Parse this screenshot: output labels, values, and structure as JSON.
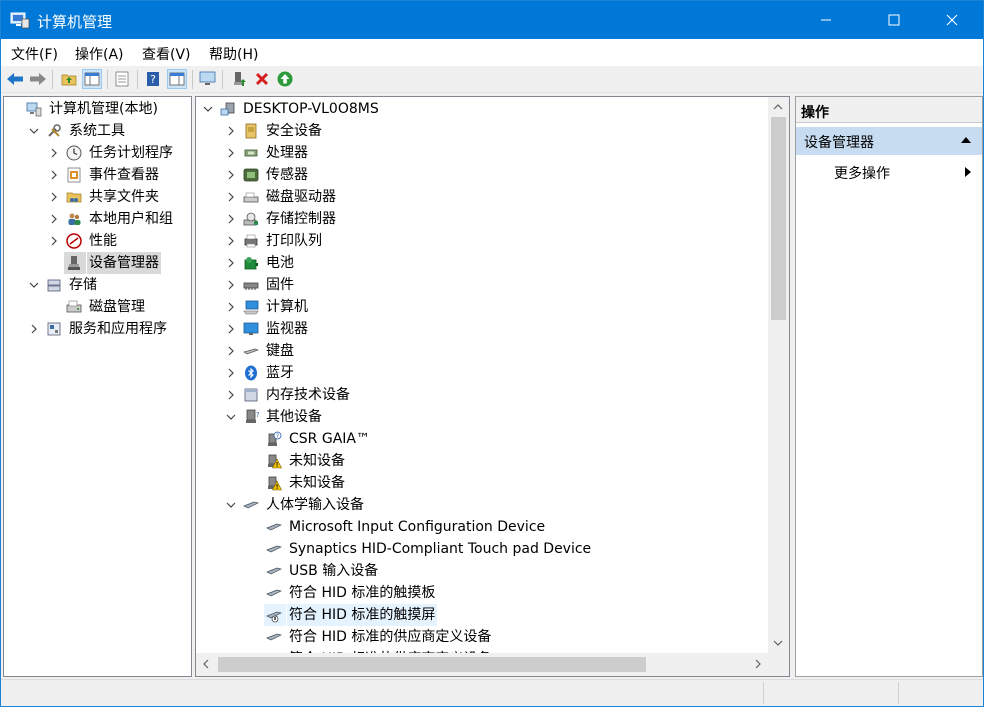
{
  "window": {
    "title": "计算机管理"
  },
  "menu": [
    {
      "label": "文件(F)"
    },
    {
      "label": "操作(A)"
    },
    {
      "label": "查看(V)"
    },
    {
      "label": "帮助(H)"
    }
  ],
  "left_tree": [
    {
      "label": "计算机管理(本地)",
      "indent": 0,
      "chevron": "",
      "icon": "computer-management-icon"
    },
    {
      "label": "系统工具",
      "indent": 1,
      "chevron": "down",
      "icon": "tools-icon"
    },
    {
      "label": "任务计划程序",
      "indent": 2,
      "chevron": "right",
      "icon": "clock-icon"
    },
    {
      "label": "事件查看器",
      "indent": 2,
      "chevron": "right",
      "icon": "event-viewer-icon"
    },
    {
      "label": "共享文件夹",
      "indent": 2,
      "chevron": "right",
      "icon": "shared-folder-icon"
    },
    {
      "label": "本地用户和组",
      "indent": 2,
      "chevron": "right",
      "icon": "users-icon"
    },
    {
      "label": "性能",
      "indent": 2,
      "chevron": "right",
      "icon": "performance-icon"
    },
    {
      "label": "设备管理器",
      "indent": 2,
      "chevron": "",
      "icon": "device-manager-icon",
      "selected": true
    },
    {
      "label": "存储",
      "indent": 1,
      "chevron": "down",
      "icon": "storage-icon"
    },
    {
      "label": "磁盘管理",
      "indent": 2,
      "chevron": "",
      "icon": "disk-management-icon"
    },
    {
      "label": "服务和应用程序",
      "indent": 1,
      "chevron": "right",
      "icon": "services-icon"
    }
  ],
  "device_tree": [
    {
      "label": "DESKTOP-VL0O8MS",
      "indent": 0,
      "chevron": "down",
      "icon": "computer-icon"
    },
    {
      "label": "安全设备",
      "indent": 1,
      "chevron": "right",
      "icon": "security-device-icon"
    },
    {
      "label": "处理器",
      "indent": 1,
      "chevron": "right",
      "icon": "processor-icon"
    },
    {
      "label": "传感器",
      "indent": 1,
      "chevron": "right",
      "icon": "sensor-icon"
    },
    {
      "label": "磁盘驱动器",
      "indent": 1,
      "chevron": "right",
      "icon": "disk-drive-icon"
    },
    {
      "label": "存储控制器",
      "indent": 1,
      "chevron": "right",
      "icon": "storage-controller-icon"
    },
    {
      "label": "打印队列",
      "indent": 1,
      "chevron": "right",
      "icon": "printer-icon"
    },
    {
      "label": "电池",
      "indent": 1,
      "chevron": "right",
      "icon": "battery-icon"
    },
    {
      "label": "固件",
      "indent": 1,
      "chevron": "right",
      "icon": "firmware-icon"
    },
    {
      "label": "计算机",
      "indent": 1,
      "chevron": "right",
      "icon": "monitor-icon"
    },
    {
      "label": "监视器",
      "indent": 1,
      "chevron": "right",
      "icon": "display-icon"
    },
    {
      "label": "键盘",
      "indent": 1,
      "chevron": "right",
      "icon": "keyboard-icon"
    },
    {
      "label": "蓝牙",
      "indent": 1,
      "chevron": "right",
      "icon": "bluetooth-icon"
    },
    {
      "label": "内存技术设备",
      "indent": 1,
      "chevron": "right",
      "icon": "memory-device-icon"
    },
    {
      "label": "其他设备",
      "indent": 1,
      "chevron": "down",
      "icon": "other-devices-icon"
    },
    {
      "label": "CSR GAIA™",
      "indent": 2,
      "chevron": "",
      "icon": "unknown-device-icon"
    },
    {
      "label": "未知设备",
      "indent": 2,
      "chevron": "",
      "icon": "warning-device-icon"
    },
    {
      "label": "未知设备",
      "indent": 2,
      "chevron": "",
      "icon": "warning-device-icon"
    },
    {
      "label": "人体学输入设备",
      "indent": 1,
      "chevron": "down",
      "icon": "hid-icon"
    },
    {
      "label": "Microsoft Input Configuration Device",
      "indent": 2,
      "chevron": "",
      "icon": "hid-icon"
    },
    {
      "label": "Synaptics HID-Compliant Touch pad Device",
      "indent": 2,
      "chevron": "",
      "icon": "hid-icon"
    },
    {
      "label": "USB 输入设备",
      "indent": 2,
      "chevron": "",
      "icon": "hid-icon"
    },
    {
      "label": "符合 HID 标准的触摸板",
      "indent": 2,
      "chevron": "",
      "icon": "hid-icon"
    },
    {
      "label": "符合 HID 标准的触摸屏",
      "indent": 2,
      "chevron": "",
      "icon": "hid-disabled-icon",
      "selected": true
    },
    {
      "label": "符合 HID 标准的供应商定义设备",
      "indent": 2,
      "chevron": "",
      "icon": "hid-icon"
    },
    {
      "label": "符合 HID 标准的供应商定义设备",
      "indent": 2,
      "chevron": "",
      "icon": "hid-icon"
    }
  ],
  "actions": {
    "header": "操作",
    "section": "设备管理器",
    "more": "更多操作"
  },
  "colors": {
    "accent": "#0078d7",
    "selection": "#e5f3ff",
    "section_bg": "#c7dcf0"
  }
}
